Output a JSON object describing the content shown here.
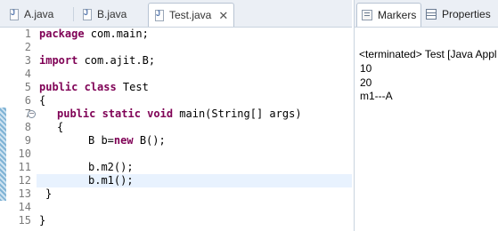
{
  "editor": {
    "tabs": [
      {
        "label": "A.java"
      },
      {
        "label": "B.java"
      },
      {
        "label": "Test.java",
        "close": "✕"
      }
    ],
    "line_numbers": [
      "1",
      "2",
      "3",
      "4",
      "5",
      "6",
      "7",
      "8",
      "9",
      "10",
      "11",
      "12",
      "13",
      "14",
      "15"
    ],
    "lines": [
      {
        "kw": "package",
        "rest": " com.main;"
      },
      {
        "kw": "",
        "rest": ""
      },
      {
        "kw": "import",
        "rest": " com.ajit.B;"
      },
      {
        "kw": "",
        "rest": ""
      },
      {
        "kw": "public class",
        "rest": " Test"
      },
      {
        "kw": "",
        "rest": "{"
      },
      {
        "kw": "public static void",
        "rest": " main(String[] args)"
      },
      {
        "kw": "",
        "rest": "{"
      },
      {
        "pre": "B b=",
        "kw": "new",
        "rest": " B();"
      },
      {
        "kw": "",
        "rest": ""
      },
      {
        "kw": "",
        "rest": "b.m2();"
      },
      {
        "kw": "",
        "rest": "b.m1();"
      },
      {
        "kw": "",
        "rest": "}"
      },
      {
        "kw": "",
        "rest": ""
      },
      {
        "kw": "",
        "rest": "}"
      }
    ],
    "fold_marker": "−",
    "colors": {
      "keyword": "#7f0055",
      "current_line": "#e8f2fe"
    }
  },
  "console": {
    "tabs": [
      {
        "label": "Markers",
        "icon": "markers-icon"
      },
      {
        "label": "Properties",
        "icon": "properties-icon"
      }
    ],
    "status": "<terminated> Test [Java Appl",
    "output": [
      "10",
      "20",
      "m1---A"
    ]
  }
}
